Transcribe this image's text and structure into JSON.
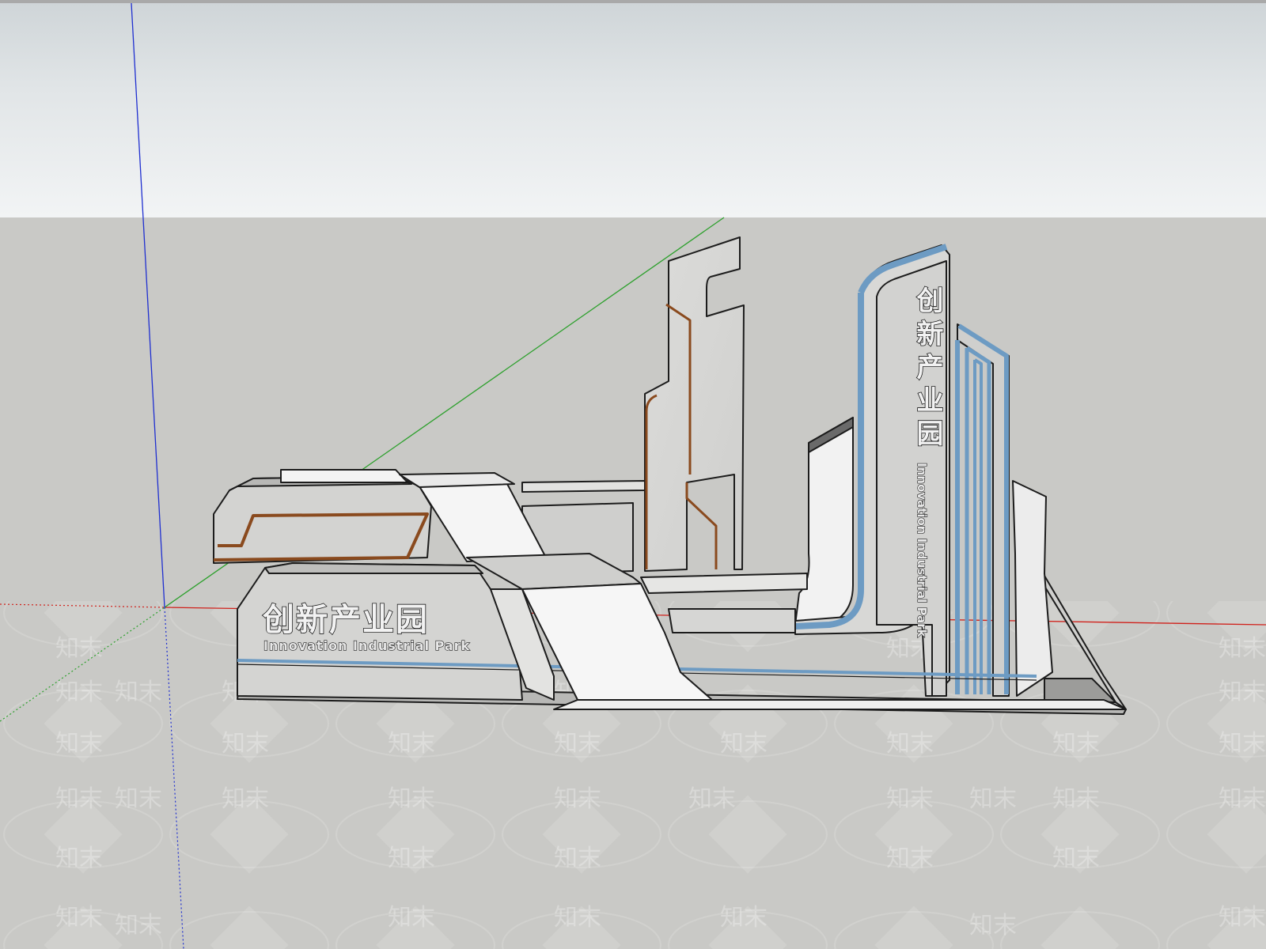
{
  "scene": {
    "model_title_cn": "创新产业园",
    "model_title_en": "Innovation Industrial Park",
    "watermark_text": "知末"
  },
  "colors": {
    "sky": "#e6eaec",
    "ground": "#c9c9c6",
    "axis_red": "#d0201a",
    "axis_green": "#2ca02c",
    "axis_blue": "#1f2fd0",
    "panel_fill": "#d6d6d4",
    "accent_blue": "#6d9bc3",
    "accent_brown": "#8a4a1e",
    "edge": "#1c1c1c"
  }
}
